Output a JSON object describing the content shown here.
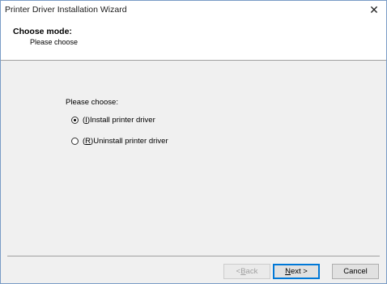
{
  "window": {
    "title": "Printer Driver Installation Wizard",
    "close_glyph": "✕"
  },
  "header": {
    "title": "Choose mode:",
    "subtitle": "Please choose"
  },
  "content": {
    "prompt": "Please choose:",
    "options": [
      {
        "prefix": "(",
        "mnemonic": "I",
        "suffix": ")Install printer driver",
        "selected": true
      },
      {
        "prefix": "(",
        "mnemonic": "R",
        "suffix": ")Uninstall printer driver",
        "selected": false
      }
    ]
  },
  "buttons": {
    "back": {
      "prefix": "< ",
      "mnemonic": "B",
      "suffix": "ack",
      "enabled": false
    },
    "next": {
      "mnemonic": "N",
      "suffix": "ext >",
      "enabled": true
    },
    "cancel": {
      "label": "Cancel",
      "enabled": true
    }
  }
}
